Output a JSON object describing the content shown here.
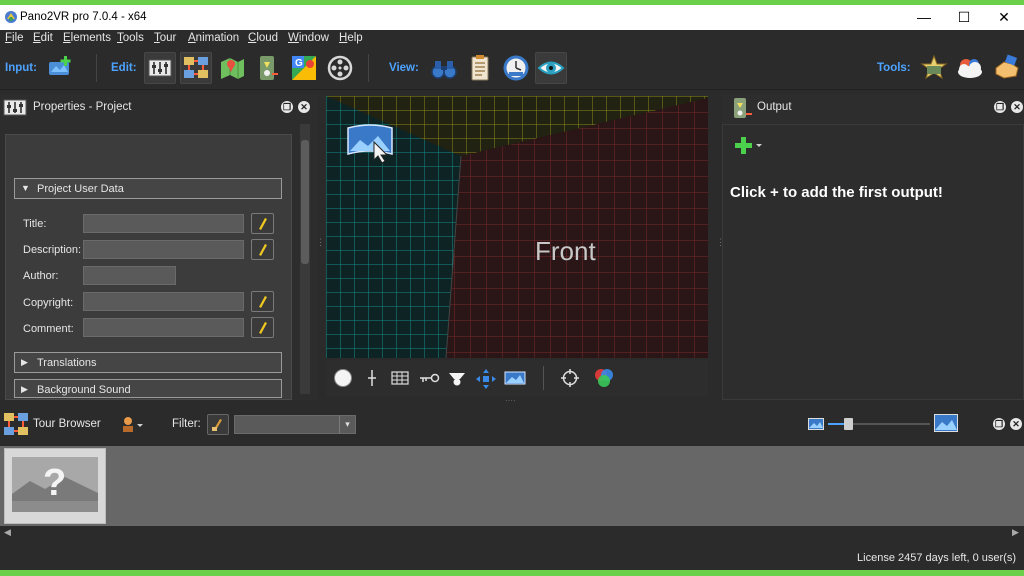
{
  "window": {
    "title": "Pano2VR pro 7.0.4 - x64",
    "minimize_glyph": "—",
    "maximize_glyph": "☐",
    "close_glyph": "✕"
  },
  "menu": [
    {
      "label": "File",
      "underline": "F",
      "rest": "ile"
    },
    {
      "label": "Edit",
      "underline": "E",
      "rest": "dit"
    },
    {
      "label": "Elements",
      "underline": "E",
      "rest": "lements"
    },
    {
      "label": "Tools",
      "underline": "T",
      "rest": "ools"
    },
    {
      "label": "Tour",
      "underline": "T",
      "rest": "our"
    },
    {
      "label": "Animation",
      "underline": "A",
      "rest": "nimation"
    },
    {
      "label": "Cloud",
      "underline": "C",
      "rest": "loud"
    },
    {
      "label": "Window",
      "underline": "W",
      "rest": "indow"
    },
    {
      "label": "Help",
      "underline": "H",
      "rest": "elp"
    }
  ],
  "toolbar": {
    "input_label": "Input:",
    "edit_label": "Edit:",
    "view_label": "View:",
    "tools_label": "Tools:",
    "input_buttons": [
      "add-panorama-icon"
    ],
    "edit_buttons": [
      "properties-sliders-icon",
      "tour-map-icon",
      "map-pin-icon",
      "hotspot-icon",
      "google-maps-icon",
      "film-reel-icon"
    ],
    "view_buttons": [
      "binoculars-icon",
      "clipboard-icon",
      "clock-gauge-icon",
      "eye-icon"
    ],
    "tools_buttons": [
      "star-wizard-icon",
      "cloud-icon",
      "hand-icon"
    ]
  },
  "properties": {
    "title": "Properties - Project",
    "tabs": [
      "project-tab-icon",
      "panorama-tab-icon",
      "id-card-tab-icon",
      "output-tab-icon"
    ],
    "project_user_data": "Project User Data",
    "fields": [
      {
        "label": "Title:",
        "value": ""
      },
      {
        "label": "Description:",
        "value": ""
      },
      {
        "label": "Author:",
        "value": ""
      },
      {
        "label": "Copyright:",
        "value": ""
      },
      {
        "label": "Comment:",
        "value": ""
      }
    ],
    "translations": "Translations",
    "background_sound": "Background Sound"
  },
  "viewer": {
    "front_label": "Front",
    "colors": {
      "front_grid": "#8a2a2a",
      "left_grid": "#1fa0a0",
      "top_grid": "#a0a020"
    }
  },
  "viewer_toolbar": [
    "compass-icon",
    "crosshair-line-icon",
    "grid-icon",
    "key-icon",
    "projector-icon",
    "move-arrows-icon",
    "panorama-view-icon",
    "target-icon",
    "color-circles-icon"
  ],
  "output": {
    "title": "Output",
    "add_glyph": "+",
    "hint": "Click + to add the first output!"
  },
  "tour_browser": {
    "title": "Tour Browser",
    "filter_label": "Filter:",
    "filter_value": "",
    "zoom_level": 0.2,
    "dropdown_glyph": "▾"
  },
  "status": {
    "license": "License 2457 days left, 0 user(s)"
  },
  "colors": {
    "accent": "#4da3ff",
    "frame_green": "#6ad04a",
    "panel_bg": "#2d2d2d"
  }
}
